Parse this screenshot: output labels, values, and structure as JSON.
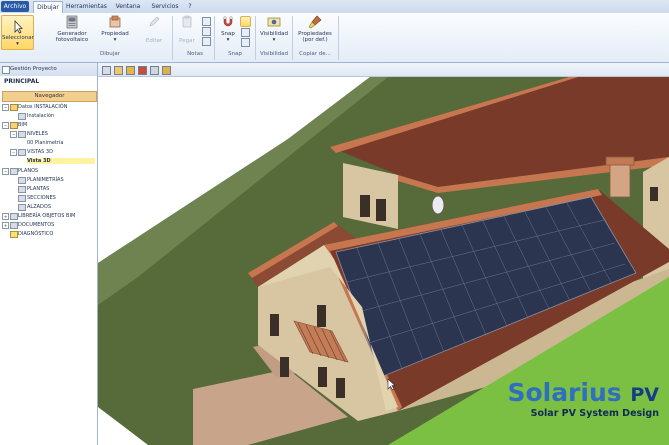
{
  "menu": {
    "file": "Archivo",
    "tabs": [
      "Dibujar",
      "Herramientas",
      "Ventana",
      "Servicios",
      "?"
    ]
  },
  "ribbon": {
    "select_label": "Seleccionar",
    "pv_generator_label_1": "Generador",
    "pv_generator_label_2": "fotovoltaico",
    "properties_label": "Propiedad",
    "edit_label": "Editar",
    "draw_group": "Dibujar",
    "paste_label": "Pegar",
    "notes_group": "Notas",
    "snap_label": "Snap",
    "snap_group": "Snap",
    "visibility_label": "Visibilidad",
    "visibility_group": "Visibilidad",
    "default_props_label_1": "Propiedades",
    "default_props_label_2": "(por def.)",
    "copy_group": "Copiar de..."
  },
  "left_panel": {
    "title": "Gestión Proyecto",
    "principal": "PRINCIPAL",
    "navigator_header": "Navegador",
    "tree": {
      "datos": "Datos INSTALACIÓN",
      "instalacion": "Instalación",
      "bim": "BIM",
      "niveles": "NIVELES",
      "planimetria": "00 Planimetría",
      "vistas3d": "VISTAS 3D",
      "vista3d": "Vista 3D",
      "planos": "PLANOS",
      "planimetrias": "PLANIMETRÍAS",
      "plantas": "PLANTAS",
      "secciones": "SECCIONES",
      "alzados": "ALZADOS",
      "libreria": "LIBRERÍA OBJETOS BIM",
      "documentos": "DOCUMENTOS",
      "diagnostico": "DIAGNÓSTICO"
    }
  },
  "logo": {
    "title": "Solarius",
    "title_suffix": "PV",
    "subtitle": "Solar PV System Design"
  },
  "colors": {
    "accent": "#2a5aa6",
    "ground": "#566a3a",
    "roof": "#7a3a2a",
    "panel": "#2b3550",
    "logo_green": "#7cc043"
  }
}
